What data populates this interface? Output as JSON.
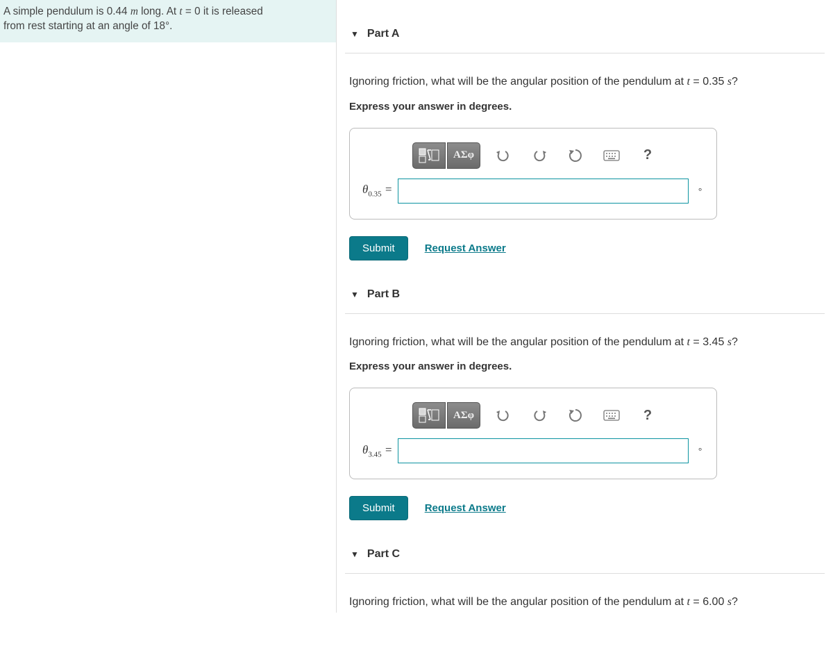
{
  "problem": {
    "line1_pre": "A simple pendulum is 0.44 ",
    "unit_m": "m",
    "line1_mid": " long. At ",
    "var_t": "t",
    "eq0": " = 0 it is released",
    "line2": "from rest starting at an angle of 18°."
  },
  "parts": {
    "A": {
      "title": "Part A",
      "q_pre": "Ignoring friction, what will be the angular position of the pendulum at ",
      "var": "t",
      "q_post": " = 0.35 ",
      "sec": "s",
      "qmark": "?",
      "hint": "Express your answer in degrees.",
      "lhs_theta": "θ",
      "lhs_sub": "0.35",
      "lhs_eq": " =",
      "unit": "°",
      "submit": "Submit",
      "request": "Request Answer",
      "greek": "ΑΣφ",
      "help": "?"
    },
    "B": {
      "title": "Part B",
      "q_pre": "Ignoring friction, what will be the angular position of the pendulum at ",
      "var": "t",
      "q_post": " = 3.45 ",
      "sec": "s",
      "qmark": "?",
      "hint": "Express your answer in degrees.",
      "lhs_theta": "θ",
      "lhs_sub": "3.45",
      "lhs_eq": " =",
      "unit": "°",
      "submit": "Submit",
      "request": "Request Answer",
      "greek": "ΑΣφ",
      "help": "?"
    },
    "C": {
      "title": "Part C",
      "q_pre": "Ignoring friction, what will be the angular position of the pendulum at ",
      "var": "t",
      "q_post": " = 6.00 ",
      "sec": "s",
      "qmark": "?"
    }
  }
}
